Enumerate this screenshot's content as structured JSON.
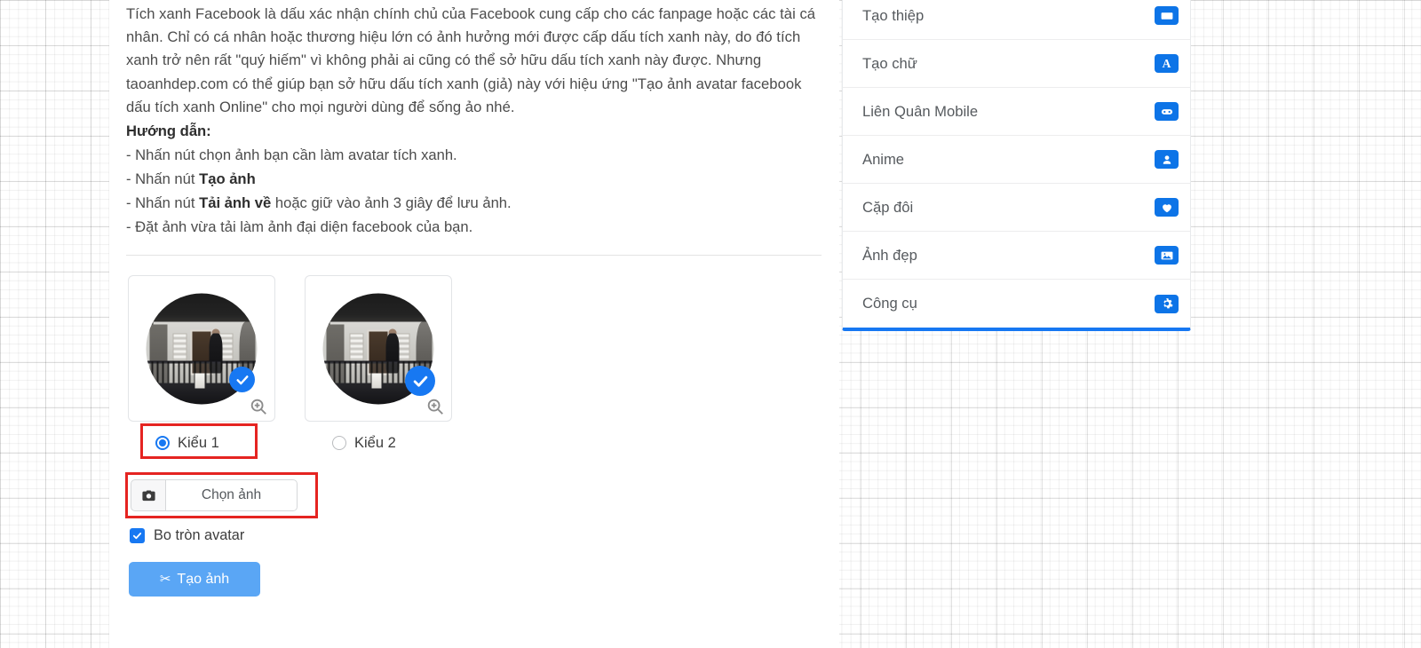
{
  "article": {
    "intro_paragraph": "Tích xanh Facebook là dấu xác nhận chính chủ của Facebook cung cấp cho các fanpage hoặc các tài cá nhân. Chỉ có cá nhân hoặc thương hiệu lớn có ảnh hưởng mới được cấp dấu tích xanh này, do đó tích xanh trở nên rất \"quý hiếm\" vì không phải ai cũng có thể sở hữu dấu tích xanh này được. Nhưng taoanhdep.com có thể giúp bạn sở hữu dấu tích xanh (giả) này với hiệu ứng \"Tạo ảnh avatar facebook dấu tích xanh Online\" cho mọi người dùng để sống ảo nhé.",
    "guide_heading": "Hướng dẫn:",
    "steps": [
      {
        "prefix": "- Nhấn nút chọn ảnh bạn cần làm avatar tích xanh.",
        "bold": "",
        "suffix": ""
      },
      {
        "prefix": "- Nhấn nút ",
        "bold": "Tạo ảnh",
        "suffix": ""
      },
      {
        "prefix": "- Nhấn nút ",
        "bold": "Tải ảnh về",
        "suffix": " hoặc giữ vào ảnh 3 giây để lưu ảnh."
      },
      {
        "prefix": "- Đặt ảnh vừa tải làm ảnh đại diện facebook của bạn.",
        "bold": "",
        "suffix": ""
      }
    ]
  },
  "styles": {
    "options": [
      {
        "label": "Kiểu 1",
        "selected": true
      },
      {
        "label": "Kiểu 2",
        "selected": false
      }
    ],
    "zoom_icon": "magnifier-plus-icon",
    "verified_icon": "blue-verified-check-icon"
  },
  "form": {
    "camera_icon": "camera-icon",
    "choose_image_label": "Chọn ảnh",
    "round_avatar_label": "Bo tròn avatar",
    "round_avatar_checked": true,
    "generate_label": "Tạo ảnh",
    "generate_icon": "scissors-icon"
  },
  "sidebar": {
    "items": [
      {
        "label": "Tạo thiệp",
        "icon": "card-icon"
      },
      {
        "label": "Tạo chữ",
        "icon": "letter-a-icon"
      },
      {
        "label": "Liên Quân Mobile",
        "icon": "gamepad-icon"
      },
      {
        "label": "Anime",
        "icon": "user-icon"
      },
      {
        "label": "Cặp đôi",
        "icon": "heart-icon"
      },
      {
        "label": "Ảnh đẹp",
        "icon": "image-icon"
      },
      {
        "label": "Công cụ",
        "icon": "gear-icon"
      }
    ]
  },
  "colors": {
    "accent_blue": "#1778f2",
    "button_blue": "#5aa6f5",
    "icon_blue": "#0d74e7",
    "annotation_red": "#e52421"
  }
}
